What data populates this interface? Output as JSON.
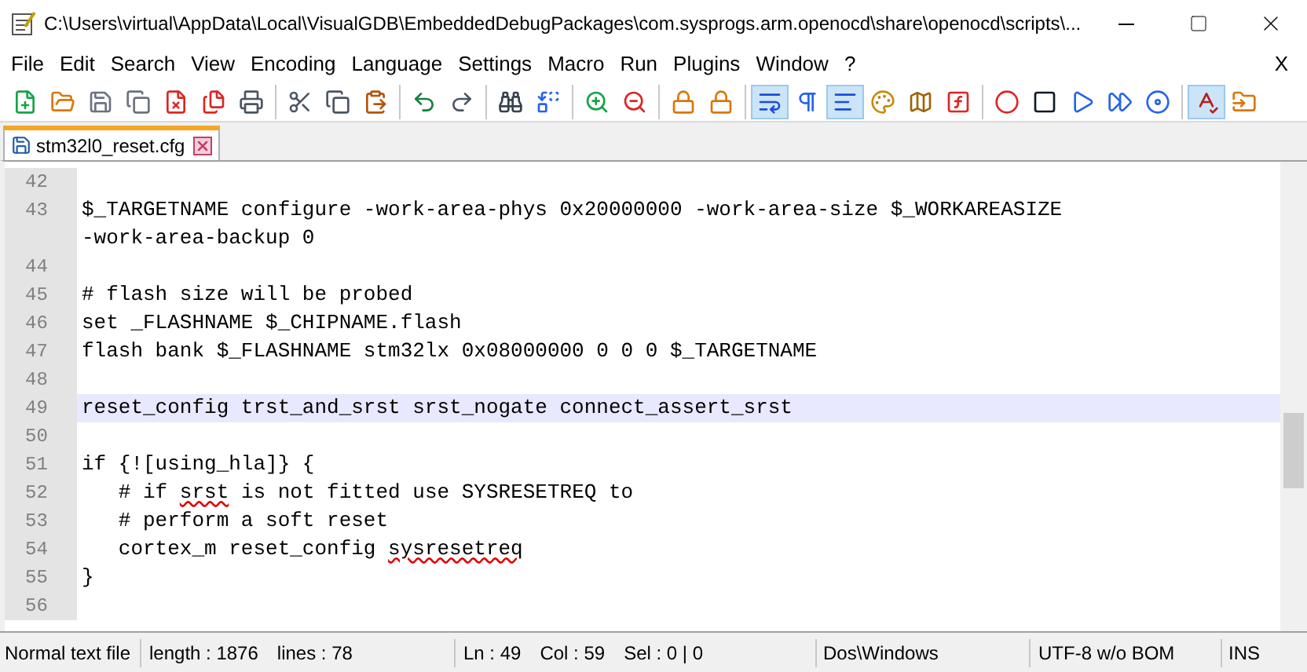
{
  "window": {
    "title": "C:\\Users\\virtual\\AppData\\Local\\VisualGDB\\EmbeddedDebugPackages\\com.sysprogs.arm.openocd\\share\\openocd\\scripts\\..."
  },
  "menu": {
    "items": [
      "File",
      "Edit",
      "Search",
      "View",
      "Encoding",
      "Language",
      "Settings",
      "Macro",
      "Run",
      "Plugins",
      "Window",
      "?"
    ],
    "close": "X"
  },
  "toolbar": [
    {
      "buttons": [
        {
          "pressed": false
        },
        {
          "pressed": false
        },
        {
          "pressed": false
        },
        {
          "pressed": false
        },
        {
          "pressed": false
        },
        {
          "pressed": false
        },
        {
          "pressed": false
        }
      ]
    },
    {
      "buttons": [
        {
          "pressed": false
        },
        {
          "pressed": false
        },
        {
          "pressed": false
        }
      ]
    },
    {
      "buttons": [
        {
          "pressed": false
        },
        {
          "pressed": false
        }
      ]
    },
    {
      "buttons": [
        {
          "pressed": false
        },
        {
          "pressed": false
        }
      ]
    },
    {
      "buttons": [
        {
          "pressed": false
        },
        {
          "pressed": false
        }
      ]
    },
    {
      "buttons": [
        {
          "pressed": false
        },
        {
          "pressed": false
        }
      ]
    },
    {
      "buttons": [
        {
          "pressed": true
        },
        {
          "pressed": false
        },
        {
          "pressed": true
        },
        {
          "pressed": false
        },
        {
          "pressed": false
        },
        {
          "pressed": false
        }
      ]
    },
    {
      "buttons": [
        {
          "pressed": false
        },
        {
          "pressed": false
        },
        {
          "pressed": false
        },
        {
          "pressed": false
        },
        {
          "pressed": false
        }
      ]
    },
    {
      "buttons": [
        {
          "pressed": true
        },
        {
          "pressed": false
        }
      ]
    }
  ],
  "tabs": [
    {
      "label": "stm32l0_reset.cfg",
      "selected": true
    }
  ],
  "editor": {
    "lines": [
      {
        "number": "42",
        "current": false
      },
      {
        "number": "43",
        "text": "$_TARGETNAME configure -work-area-phys 0x20000000 -work-area-size $_WORKAREASIZE",
        "continuation": "-work-area-backup 0",
        "current": false
      },
      {
        "number": "44",
        "current": false
      },
      {
        "number": "45",
        "text": "# flash size will be probed",
        "current": false
      },
      {
        "number": "46",
        "text": "set _FLASHNAME $_CHIPNAME.flash",
        "current": false
      },
      {
        "number": "47",
        "text": "flash bank $_FLASHNAME stm32lx 0x08000000 0 0 0 $_TARGETNAME",
        "current": false
      },
      {
        "number": "48",
        "current": false
      },
      {
        "number": "49",
        "text": "reset_config trst_and_srst srst_nogate connect_assert_srst",
        "current": true
      },
      {
        "number": "50",
        "current": false
      },
      {
        "number": "51",
        "text": "if {![using_hla]} {",
        "current": false
      },
      {
        "number": "52",
        "segments": [
          {
            "text": "   # if ",
            "misspelled": false
          },
          {
            "text": "srst",
            "misspelled": true
          },
          {
            "text": " is not fitted use SYSRESETREQ to",
            "misspelled": false
          }
        ],
        "current": false
      },
      {
        "number": "53",
        "text": "   # perform a soft reset",
        "current": false
      },
      {
        "number": "54",
        "segments": [
          {
            "text": "   cortex_m reset_config ",
            "misspelled": false
          },
          {
            "text": "sysresetreq",
            "misspelled": true
          }
        ],
        "current": false
      },
      {
        "number": "55",
        "text": "}",
        "current": false
      },
      {
        "number": "56",
        "current": false
      }
    ]
  },
  "status_bar": {
    "file_type": "Normal text file",
    "length": "length : 1876",
    "lines": "lines : 78",
    "ln": "Ln : 49",
    "col": "Col : 59",
    "sel": "Sel : 0 | 0",
    "eol": "Dos\\Windows",
    "encoding": "UTF-8 w/o BOM",
    "mode": "INS"
  }
}
